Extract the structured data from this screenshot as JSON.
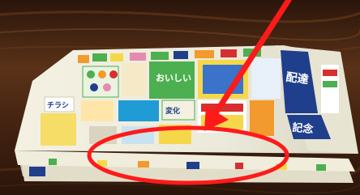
{
  "photo": {
    "subject": "stack of folded newspaper-insert flyers lying on a wooden table",
    "colors": {
      "table_dark": "#2a150a",
      "table_mid": "#5a3218",
      "table_light": "#7a4a26",
      "paper": "#f4f1e2",
      "paper_shadow": "#cfc9b2",
      "annotation_red": "#ff1a1a",
      "ad_blue": "#1f3f8c",
      "ad_green": "#4caf50",
      "ad_yellow": "#f5d84a",
      "ad_orange": "#f29a2e",
      "ad_red": "#d62f2f",
      "ad_pink": "#e58bb0"
    }
  },
  "flyer_texts": {
    "ad_main": "おいしい",
    "ad_right_1": "配達",
    "ad_right_2": "記念",
    "ad_center": "変化",
    "ad_left": "チラシ"
  },
  "annotation": {
    "type": "red arrow and ellipse",
    "highlights": "folded edge of the flyer stack"
  }
}
